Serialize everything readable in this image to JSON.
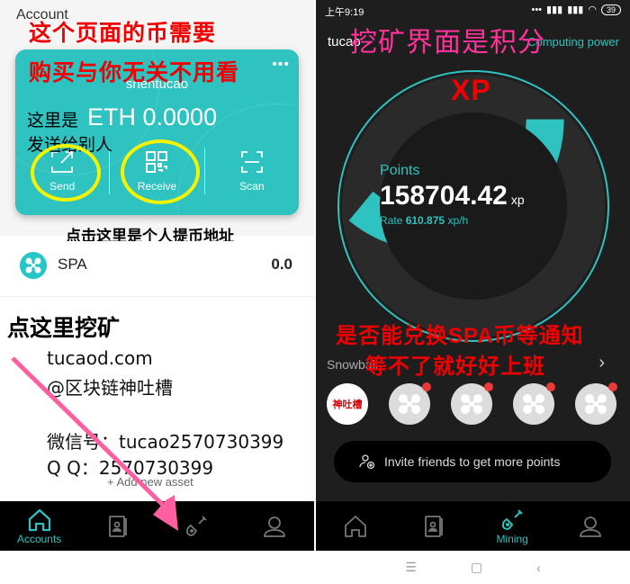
{
  "left": {
    "header_title": "Account",
    "annotation_top": [
      "这个页面的币需要",
      "购买与你无关不用看"
    ],
    "card": {
      "account_name": "shentucao",
      "more_icon": "more-dots",
      "balance_prefix_annotation": "这里是",
      "balance": "ETH 0.0000",
      "send_annotation": "发送给别人",
      "actions": [
        {
          "label": "Send",
          "icon": "send-icon"
        },
        {
          "label": "Receive",
          "icon": "qr-code-icon"
        },
        {
          "label": "Scan",
          "icon": "scan-icon"
        }
      ]
    },
    "annotation_receive": "点击这里是个人提币地址",
    "asset": {
      "name": "SPA",
      "value": "0.0"
    },
    "annotation_mining": "点这里挖矿",
    "watermark": {
      "site": "tucaod.com",
      "handle": "@区块链神吐槽",
      "wechat": "微信号：tucao2570730399",
      "qq": "Q Q：2570730399"
    },
    "add_asset": "+ Add new asset",
    "tabs": [
      {
        "label": "Accounts",
        "icon": "home-icon",
        "active": true
      },
      {
        "label": "",
        "icon": "contacts-icon",
        "active": false
      },
      {
        "label": "",
        "icon": "shovel-icon",
        "active": false
      },
      {
        "label": "",
        "icon": "user-icon",
        "active": false
      }
    ]
  },
  "right": {
    "status_bar": {
      "time": "上午9:19",
      "battery": "39"
    },
    "username": "tucao",
    "computing_power": "Computing power",
    "annotation_title": "挖矿界面是积分",
    "annotation_xp": "XP",
    "points_label": "Points",
    "points_value": "158704.42",
    "points_unit": "xp",
    "rate_label": "Rate",
    "rate_value": "610.875",
    "rate_unit": "xp/h",
    "progress_fraction": 0.36,
    "annotation_spa": [
      "是否能兑换SPA币等通知",
      "等不了就好好上班"
    ],
    "snowball_label": "Snowball",
    "snowball_first_label": "神吐槽",
    "snowball_count": 5,
    "invite_label": "Invite friends to get more points",
    "tabs": [
      {
        "label": "",
        "icon": "home-icon",
        "active": false
      },
      {
        "label": "",
        "icon": "contacts-icon",
        "active": false
      },
      {
        "label": "Mining",
        "icon": "shovel-icon",
        "active": true
      },
      {
        "label": "",
        "icon": "user-icon",
        "active": false
      }
    ],
    "system_nav": [
      "menu",
      "home",
      "back"
    ]
  },
  "colors": {
    "accent": "#2ec3c0",
    "annotation_red": "#f00000",
    "annotation_pink": "#ff3399",
    "highlight_yellow": "#f4f400",
    "dark_bg": "#1e1e1e"
  }
}
